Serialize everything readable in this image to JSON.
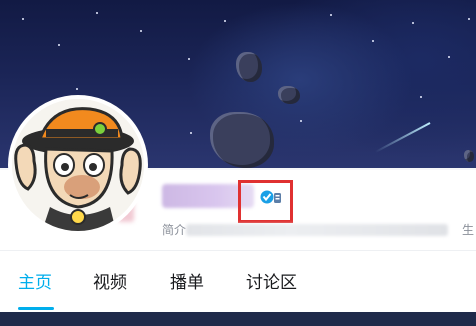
{
  "profile": {
    "username": "",
    "bio_label": "简介",
    "bio_text": "",
    "edge_char": "生"
  },
  "tabs": [
    {
      "label": "主页",
      "active": true
    },
    {
      "label": "视频",
      "active": false
    },
    {
      "label": "播单",
      "active": false
    },
    {
      "label": "讨论区",
      "active": false
    }
  ],
  "colors": {
    "accent": "#00aeec",
    "highlight": "#e03131",
    "banner_dark": "#121a44"
  },
  "icons": {
    "verify": "verified-badge-icon"
  }
}
